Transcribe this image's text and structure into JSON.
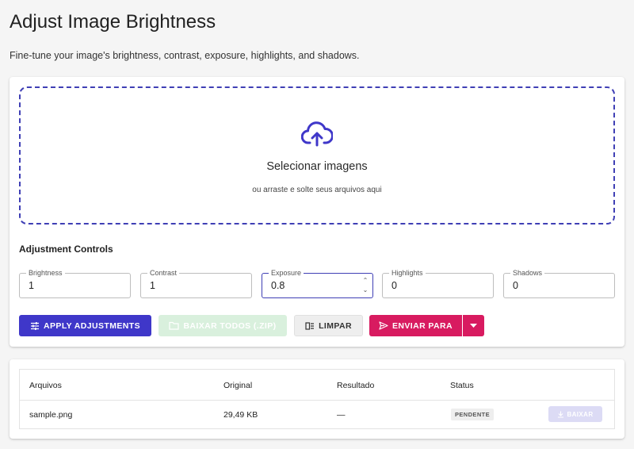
{
  "header": {
    "title": "Adjust Image Brightness",
    "subtitle": "Fine-tune your image's brightness, contrast, exposure, highlights, and shadows."
  },
  "dropzone": {
    "title": "Selecionar imagens",
    "subtitle": "ou arraste e solte seus arquivos aqui",
    "icon": "cloud-upload-icon"
  },
  "controls": {
    "title": "Adjustment Controls",
    "fields": [
      {
        "label": "Brightness",
        "value": "1"
      },
      {
        "label": "Contrast",
        "value": "1"
      },
      {
        "label": "Exposure",
        "value": "0.8"
      },
      {
        "label": "Highlights",
        "value": "0"
      },
      {
        "label": "Shadows",
        "value": "0"
      }
    ]
  },
  "actions": {
    "apply_label": "APPLY ADJUSTMENTS",
    "zip_label": "BAIXAR TODOS (.ZIP)",
    "clear_label": "LIMPAR",
    "send_label": "ENVIAR PARA"
  },
  "files": {
    "columns": [
      "Arquivos",
      "Original",
      "Resultado",
      "Status"
    ],
    "rows": [
      {
        "name": "sample.png",
        "original": "29,49 KB",
        "result": "—",
        "status": "PENDENTE",
        "download_label": "BAIXAR"
      }
    ]
  },
  "colors": {
    "primary": "#3f37c9",
    "accent": "#d81b60",
    "success_disabled": "#d9f0dd"
  }
}
